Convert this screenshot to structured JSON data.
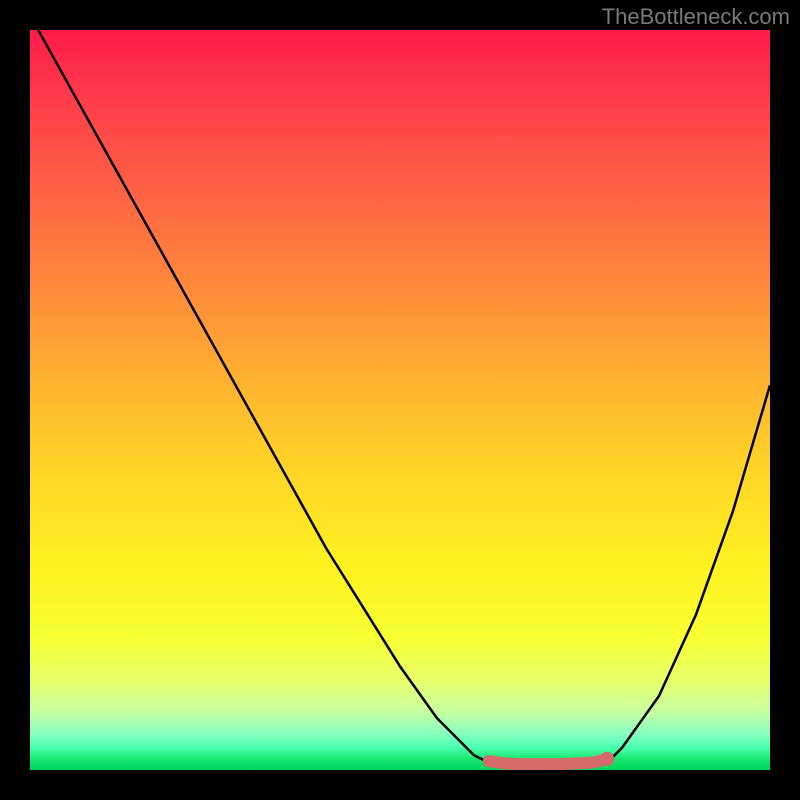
{
  "watermark": "TheBottleneck.com",
  "chart_data": {
    "type": "line",
    "title": "",
    "xlabel": "",
    "ylabel": "",
    "x_range": [
      0,
      100
    ],
    "y_range": [
      0,
      100
    ],
    "series": [
      {
        "name": "bottleneck-curve",
        "x": [
          0,
          5,
          10,
          15,
          20,
          25,
          30,
          35,
          40,
          45,
          50,
          55,
          60,
          62,
          65,
          70,
          75,
          78,
          80,
          85,
          90,
          95,
          100
        ],
        "values": [
          102,
          93,
          84,
          75,
          66,
          57,
          48,
          39,
          30,
          22,
          14,
          7,
          2,
          1,
          0.5,
          0.5,
          0.5,
          1,
          3,
          10,
          21,
          35,
          52
        ]
      },
      {
        "name": "sweet-spot-marker",
        "x": [
          62,
          64,
          66,
          68,
          70,
          72,
          74,
          76,
          78
        ],
        "values": [
          1.2,
          0.9,
          0.8,
          0.8,
          0.8,
          0.8,
          0.9,
          1.0,
          1.5
        ]
      }
    ],
    "gradient_stops": [
      {
        "pct": 0,
        "color": "#ff1a4a"
      },
      {
        "pct": 10,
        "color": "#ff3e4a"
      },
      {
        "pct": 22,
        "color": "#ff6243"
      },
      {
        "pct": 35,
        "color": "#ff8a3a"
      },
      {
        "pct": 48,
        "color": "#ffb32f"
      },
      {
        "pct": 60,
        "color": "#ffd626"
      },
      {
        "pct": 72,
        "color": "#fff020"
      },
      {
        "pct": 82,
        "color": "#f7ff30"
      },
      {
        "pct": 88,
        "color": "#e6ff6a"
      },
      {
        "pct": 92,
        "color": "#c8ffa0"
      },
      {
        "pct": 95,
        "color": "#8affc0"
      },
      {
        "pct": 97,
        "color": "#4affb0"
      },
      {
        "pct": 98.5,
        "color": "#18e870"
      },
      {
        "pct": 100,
        "color": "#00d65a"
      }
    ],
    "curve_color": "#000000",
    "marker_color": "#d46a6a"
  }
}
